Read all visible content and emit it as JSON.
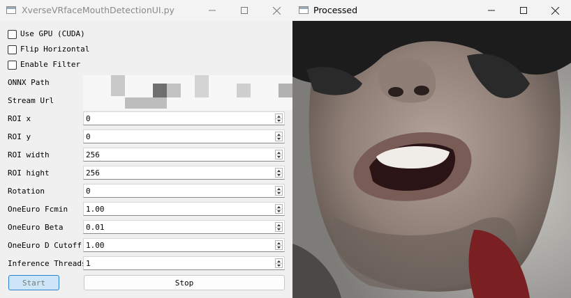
{
  "left_window": {
    "title": "XverseVRfaceMouthDetectionUI.py",
    "checkboxes": [
      {
        "label": "Use GPU (CUDA)",
        "checked": false
      },
      {
        "label": "Flip Horizontal",
        "checked": false
      },
      {
        "label": "Enable Filter",
        "checked": false
      }
    ],
    "onnx_path_label": "ONNX Path",
    "stream_url_label": "Stream Url",
    "fields": [
      {
        "label": "ROI x",
        "value": "0"
      },
      {
        "label": "ROI y",
        "value": "0"
      },
      {
        "label": "ROI width",
        "value": "256"
      },
      {
        "label": "ROI hight",
        "value": "256"
      },
      {
        "label": "Rotation",
        "value": "0"
      },
      {
        "label": "OneEuro Fcmin",
        "value": "1.00"
      },
      {
        "label": "OneEuro Beta",
        "value": "0.01"
      },
      {
        "label": "OneEuro D Cutoff",
        "value": "1.00"
      },
      {
        "label": "Inference Threads",
        "value": "1"
      }
    ],
    "start_label": "Start",
    "stop_label": "Stop"
  },
  "right_window": {
    "title": "Processed"
  },
  "icons": {
    "app": "window-icon",
    "minimize": "minimize-icon",
    "maximize": "maximize-icon",
    "close": "close-icon",
    "spin_up": "chevron-up-icon",
    "spin_down": "chevron-down-icon"
  },
  "colors": {
    "accent_button": "#cde6f7",
    "accent_border": "#2f7ecb",
    "window_bg": "#f0f0f0"
  }
}
